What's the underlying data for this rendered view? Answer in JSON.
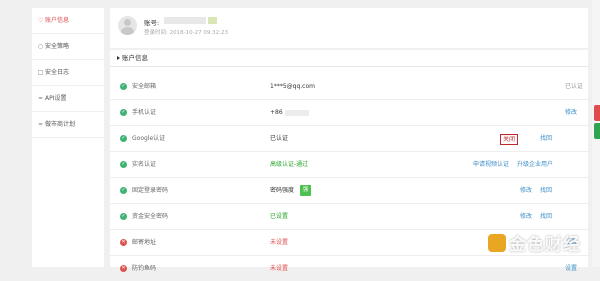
{
  "sidebar": {
    "items": [
      {
        "icon": "user-icon",
        "label": "账户信息",
        "active": true
      },
      {
        "icon": "lightbulb-icon",
        "label": "安全策略"
      },
      {
        "icon": "log-icon",
        "label": "安全日志"
      },
      {
        "icon": "api-icon",
        "label": "API设置"
      },
      {
        "icon": "partner-icon",
        "label": "做市商计划"
      }
    ]
  },
  "header": {
    "account_label": "账号:",
    "login_time": "登录时间: 2018-10-27 09:32:23"
  },
  "panel": {
    "title": "账户信息",
    "rows": [
      {
        "label": "安全邮箱",
        "value": "1***5@qq.com",
        "status": "ok",
        "actions": [
          "已认证"
        ]
      },
      {
        "label": "手机认证",
        "value": "+86",
        "status": "ok",
        "actions": [
          "修改"
        ]
      },
      {
        "label": "Google认证",
        "value": "已认证",
        "status": "ok",
        "actions": [
          "关闭",
          "找回"
        ]
      },
      {
        "label": "实名认证",
        "value": "高级认证-通过",
        "status": "ok",
        "actions": [
          "申请视频认证",
          "升级企业用户"
        ]
      },
      {
        "label": "固定登录密码",
        "value": "密码强度",
        "badge": "强",
        "status": "ok",
        "actions": [
          "修改",
          "找回"
        ]
      },
      {
        "label": "资金安全密码",
        "value": "已设置",
        "status": "ok",
        "actions": [
          "修改",
          "找回"
        ]
      },
      {
        "label": "邮寄地址",
        "value": "未设置",
        "status": "bad",
        "actions": [
          "设置"
        ]
      },
      {
        "label": "防钓鱼码",
        "value": "未设置",
        "status": "bad",
        "actions": [
          "设置"
        ]
      }
    ]
  },
  "watermark": "金色财经",
  "colors": {
    "accent_red": "#e04c4c",
    "ok_green": "#3cb371",
    "link_blue": "#3b8ec9"
  }
}
